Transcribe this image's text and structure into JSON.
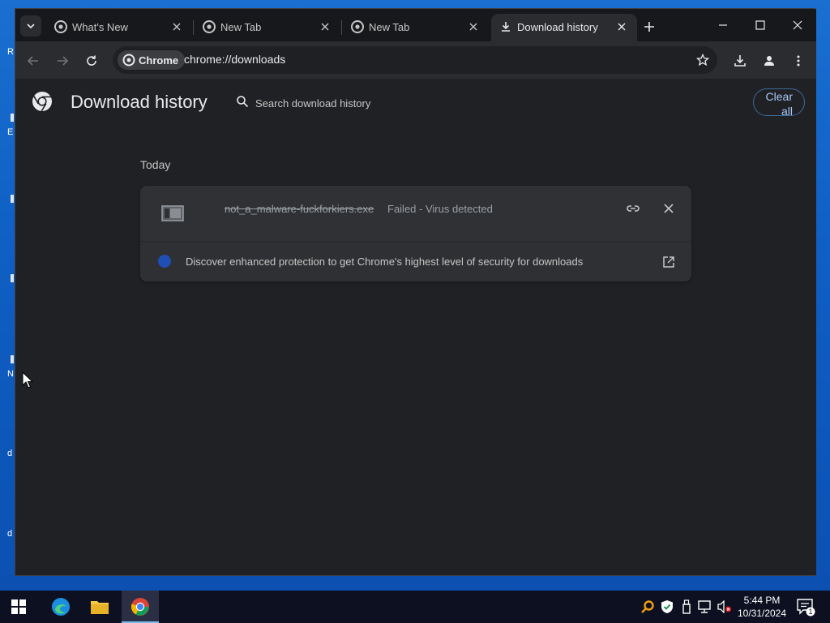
{
  "desktop": {
    "edge_chars": [
      "R",
      "E",
      "N",
      "d",
      "d"
    ]
  },
  "tabs": [
    {
      "title": "What's New",
      "icon": "chrome-icon",
      "active": false
    },
    {
      "title": "New Tab",
      "icon": "chrome-icon",
      "active": false
    },
    {
      "title": "New Tab",
      "icon": "chrome-icon",
      "active": false
    },
    {
      "title": "Download history",
      "icon": "download-icon",
      "active": true
    }
  ],
  "omnibox": {
    "chip_label": "Chrome",
    "url": "chrome://downloads"
  },
  "page": {
    "title": "Download history",
    "search_placeholder": "Search download history",
    "clear_all_line1": "Clear",
    "clear_all_line2": "all"
  },
  "downloads": {
    "date_header": "Today",
    "item": {
      "file_name": "not_a_malware-fuckforkiers.exe",
      "status": "Failed - Virus detected"
    },
    "promo_text": "Discover enhanced protection to get Chrome's highest level of security for downloads"
  },
  "taskbar": {
    "apps": [
      "start-icon",
      "edge-icon",
      "file-explorer-icon",
      "chrome-icon"
    ],
    "time": "5:44 PM",
    "date": "10/31/2024",
    "notification_count": "1"
  },
  "colors": {
    "accent": "#a8c7fa",
    "page_bg": "#202124",
    "card_bg": "#303134",
    "desktop_blue": "#0f5fc4"
  }
}
